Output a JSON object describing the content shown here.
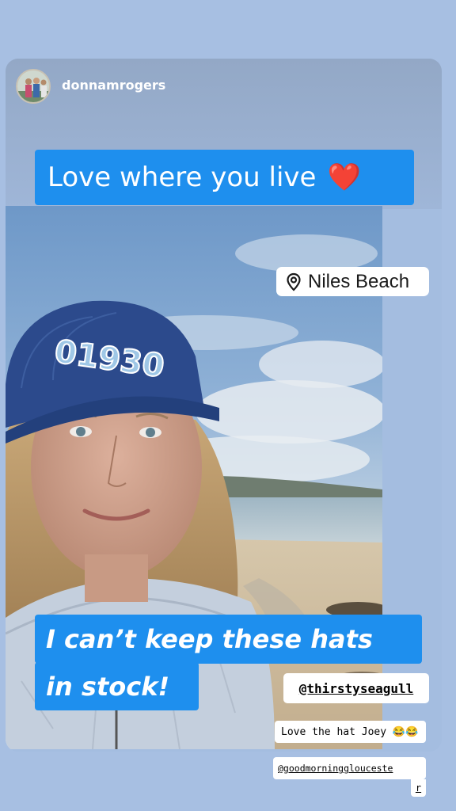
{
  "story": {
    "username": "donnamrogers",
    "avatar_icon": "profile-photo-avatar"
  },
  "captions": {
    "top_text": "Love where you live",
    "top_emoji": "❤️",
    "bottom_line1": "I can’t keep these hats",
    "bottom_line2": "in stock!"
  },
  "location": {
    "icon": "location-pin-icon",
    "label": "Niles Beach"
  },
  "stickers": {
    "mention1": "@thirstyseagull",
    "comment": "Love the hat Joey 😂😂",
    "mention2_main": "@goodmorningglouceste",
    "mention2_wrap": "r"
  },
  "photo": {
    "hat_text": "01930"
  },
  "colors": {
    "background": "#a7bfe2",
    "caption_blue": "#1e8fee",
    "sticker_white": "#ffffff",
    "hat_navy": "#2c4a8c"
  }
}
